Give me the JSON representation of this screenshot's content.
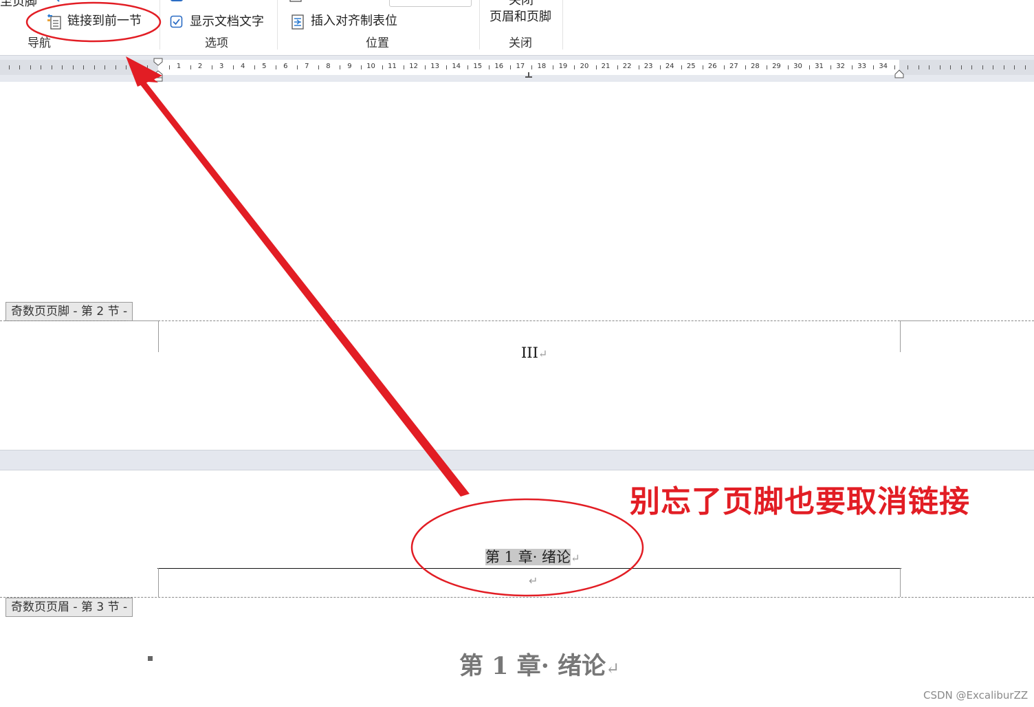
{
  "ribbon": {
    "top_cut_left": "至页脚",
    "link_prev_label": "链接到前一节",
    "nav_group": "导航",
    "show_doc_text": "显示文档文字",
    "options_group": "选项",
    "insert_tab_label": "插入对齐制表位",
    "position_group": "位置",
    "close_label_top": "关闭",
    "close_label": "页眉和页脚",
    "close_group": "关闭"
  },
  "ruler": {
    "numbers": [
      "1",
      "2",
      "3",
      "4",
      "5",
      "6",
      "7",
      "8",
      "9",
      "10",
      "11",
      "12",
      "13",
      "14",
      "15",
      "16",
      "17",
      "18",
      "19",
      "20",
      "21",
      "22",
      "23",
      "24",
      "25",
      "26",
      "27",
      "28",
      "29",
      "30",
      "31",
      "32",
      "33",
      "34"
    ]
  },
  "document": {
    "footer_tag": "奇数页页脚 - 第 2 节 -",
    "footer_page_number": "III",
    "header_tag": "奇数页页眉 - 第 3 节 -",
    "header_text": "第 1 章· 绪论",
    "paragraph_mark": "↵",
    "heading_text": "第 1 章· 绪论"
  },
  "annotation": {
    "callout": "别忘了页脚也要取消链接",
    "color": "#e21d24"
  },
  "watermark": "CSDN @ExcaliburZZ"
}
